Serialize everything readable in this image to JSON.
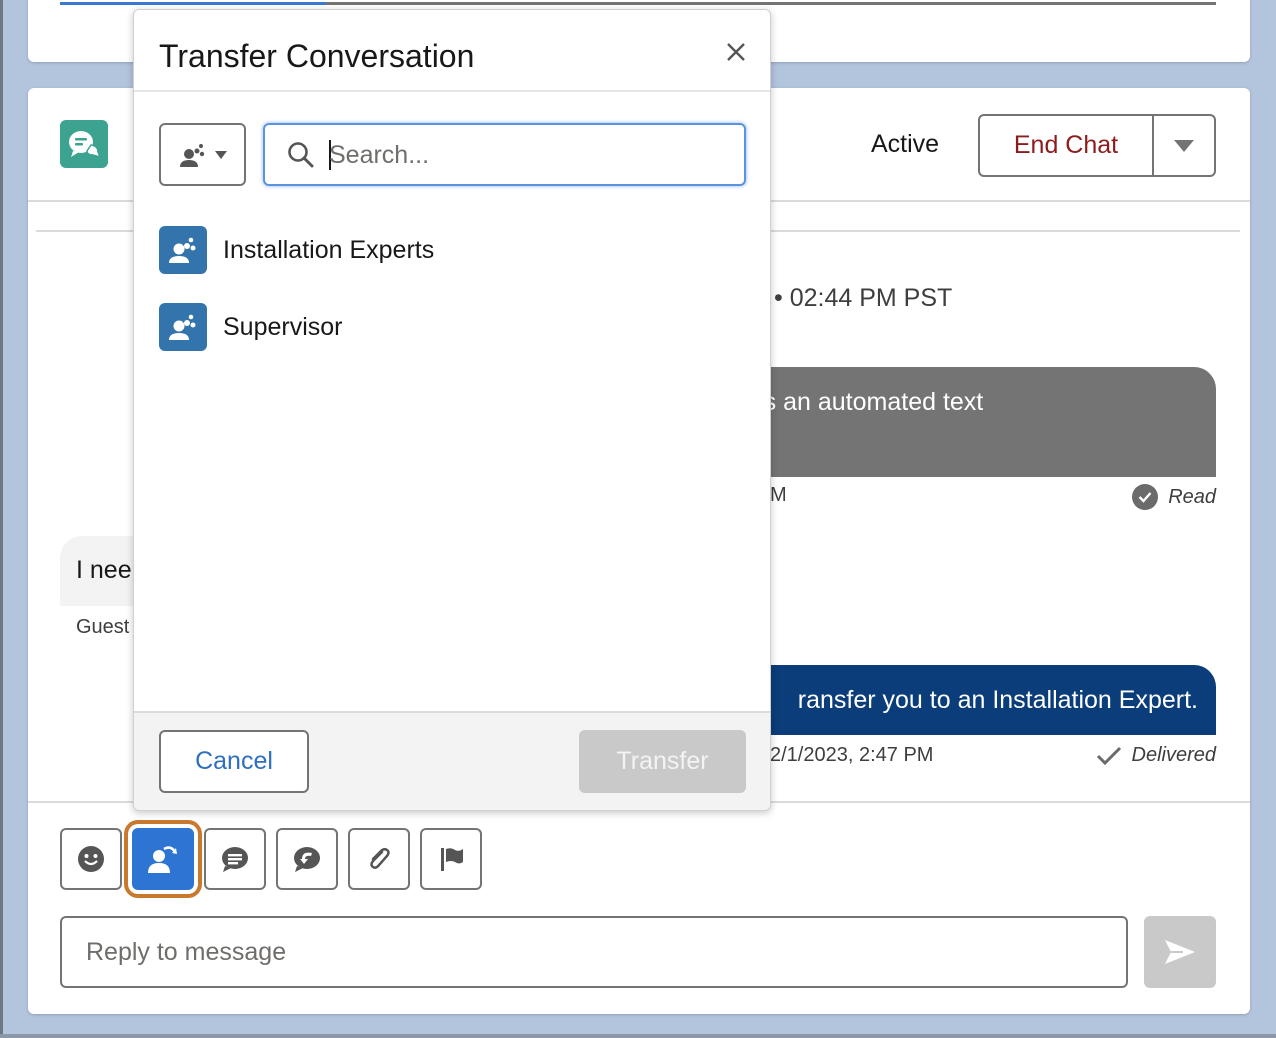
{
  "top_panel": {
    "progress_fraction": 0.23
  },
  "chat": {
    "status": "Active",
    "end_chat_label": "End Chat",
    "timestamp_line": "• 02:44 PM PST",
    "messages": [
      {
        "sender": "bot",
        "text_visible": "y! This is an automated text",
        "time_visible": "M",
        "status": "Read"
      },
      {
        "sender": "guest",
        "text_visible": "I nee",
        "label_visible": "Guest"
      },
      {
        "sender": "agent",
        "text_visible": "ransfer you to an Installation Expert.",
        "time_visible": "2/1/2023, 2:47 PM",
        "status": "Delivered"
      }
    ],
    "toolbar": [
      "emoji-icon",
      "transfer-icon",
      "quick-text-icon",
      "knowledge-icon",
      "attachment-icon",
      "flag-icon"
    ],
    "active_tool": "transfer-icon",
    "reply_placeholder": "Reply to message",
    "colors": {
      "agent_bubble": "#0b3d7a",
      "bot_bubble": "#747474",
      "end_chat_text": "#8e1b1b",
      "active_tool": "#2e74d3",
      "focus_ring": "#c9792e"
    }
  },
  "modal": {
    "title": "Transfer Conversation",
    "close_label": "Close",
    "filter_icon": "queue-group-icon",
    "search_placeholder": "Search...",
    "search_value": "",
    "results": [
      {
        "label": "Installation Experts",
        "icon": "queue-group-icon"
      },
      {
        "label": "Supervisor",
        "icon": "queue-group-icon"
      }
    ],
    "cancel_label": "Cancel",
    "transfer_label": "Transfer",
    "transfer_enabled": false
  }
}
